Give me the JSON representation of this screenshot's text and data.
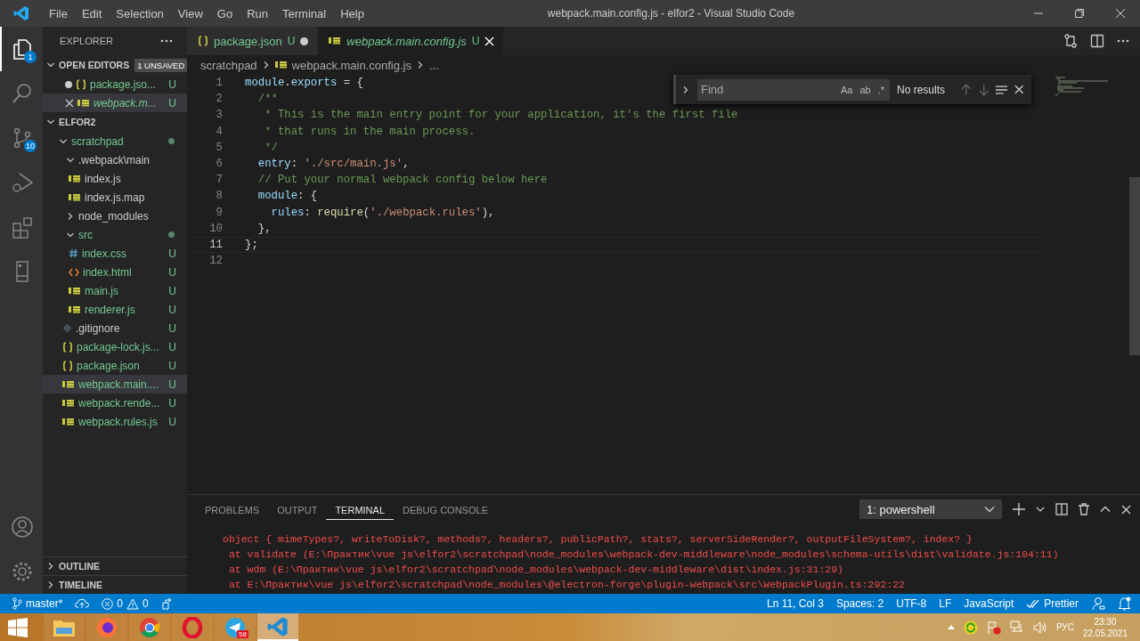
{
  "window": {
    "title": "webpack.main.config.js - elfor2 - Visual Studio Code"
  },
  "menu": [
    "File",
    "Edit",
    "Selection",
    "View",
    "Go",
    "Run",
    "Terminal",
    "Help"
  ],
  "activity_bar": [
    {
      "kind": "files",
      "selected": true,
      "badge": "1"
    },
    {
      "kind": "search",
      "selected": false
    },
    {
      "kind": "source-control",
      "selected": false,
      "badge": "10"
    },
    {
      "kind": "debug",
      "selected": false
    },
    {
      "kind": "extensions",
      "selected": false
    },
    {
      "kind": "remote",
      "selected": false
    }
  ],
  "sidebar": {
    "title": "EXPLORER",
    "open_editors": {
      "title": "OPEN EDITORS",
      "badge": "1 UNSAVED",
      "items": [
        {
          "name": "package.jso...",
          "kind": "json",
          "status": "U",
          "dirty": true,
          "italic": false,
          "selected": false
        },
        {
          "name": "webpack.m...",
          "kind": "js",
          "status": "U",
          "dirty": false,
          "italic": true,
          "selected": true
        }
      ]
    },
    "folder": {
      "title": "ELFOR2",
      "items": [
        {
          "kind": "folder",
          "name": "scratchpad",
          "expanded": true,
          "modified": true,
          "untracked": true,
          "children": [
            {
              "kind": "folder",
              "name": ".webpack\\main",
              "expanded": true,
              "modified": false,
              "untracked": false,
              "children": [
                {
                  "kind": "js",
                  "name": "index.js",
                  "untracked": false,
                  "selected": false
                },
                {
                  "kind": "js",
                  "name": "index.js.map",
                  "untracked": false,
                  "selected": false
                }
              ]
            },
            {
              "kind": "folder",
              "name": "node_modules",
              "expanded": false,
              "modified": false,
              "untracked": false
            },
            {
              "kind": "folder",
              "name": "src",
              "expanded": true,
              "modified": true,
              "untracked": true,
              "children": [
                {
                  "kind": "css",
                  "name": "index.css",
                  "status": "U",
                  "untracked": true,
                  "selected": false
                },
                {
                  "kind": "html",
                  "name": "index.html",
                  "status": "U",
                  "untracked": true,
                  "selected": false
                },
                {
                  "kind": "js",
                  "name": "main.js",
                  "status": "U",
                  "untracked": true,
                  "selected": false
                },
                {
                  "kind": "js",
                  "name": "renderer.js",
                  "status": "U",
                  "untracked": true,
                  "selected": false
                }
              ]
            },
            {
              "kind": "git",
              "name": ".gitignore",
              "status": "U",
              "untracked": false,
              "selected": false
            },
            {
              "kind": "json",
              "name": "package-lock.js...",
              "status": "U",
              "untracked": true,
              "selected": false
            },
            {
              "kind": "json",
              "name": "package.json",
              "status": "U",
              "untracked": true,
              "selected": false
            },
            {
              "kind": "js",
              "name": "webpack.main....",
              "status": "U",
              "untracked": true,
              "selected": true
            },
            {
              "kind": "js",
              "name": "webpack.rende...",
              "status": "U",
              "untracked": true,
              "selected": false
            },
            {
              "kind": "js",
              "name": "webpack.rules.js",
              "status": "U",
              "untracked": true,
              "selected": false
            }
          ]
        }
      ]
    },
    "bottom_sections": [
      "OUTLINE",
      "TIMELINE"
    ]
  },
  "editor_tabs": [
    {
      "name": "package.json",
      "kind": "json",
      "status": "U",
      "dirty": true,
      "italic": false,
      "selected": false
    },
    {
      "name": "webpack.main.config.js",
      "kind": "js",
      "status": "U",
      "dirty": false,
      "italic": true,
      "selected": true
    }
  ],
  "breadcrumbs": [
    {
      "kind": "folder",
      "text": "scratchpad"
    },
    {
      "kind": "js",
      "text": "webpack.main.config.js"
    },
    {
      "kind": "symbol",
      "text": "..."
    }
  ],
  "code": {
    "lines": [
      {
        "n": "1",
        "current": false,
        "tokens": [
          {
            "kind": "var",
            "text": "module"
          },
          {
            "kind": "plain",
            "text": "."
          },
          {
            "kind": "var",
            "text": "exports"
          },
          {
            "kind": "plain",
            "text": " = {"
          }
        ]
      },
      {
        "n": "2",
        "current": false,
        "tokens": [
          {
            "kind": "comment",
            "text": "  /**"
          }
        ]
      },
      {
        "n": "3",
        "current": false,
        "tokens": [
          {
            "kind": "comment",
            "text": "   * This is the main entry point for your application, it's the first file"
          }
        ]
      },
      {
        "n": "4",
        "current": false,
        "tokens": [
          {
            "kind": "comment",
            "text": "   * that runs in the main process."
          }
        ]
      },
      {
        "n": "5",
        "current": false,
        "tokens": [
          {
            "kind": "comment",
            "text": "   */"
          }
        ]
      },
      {
        "n": "6",
        "current": false,
        "tokens": [
          {
            "kind": "var",
            "text": "  entry"
          },
          {
            "kind": "plain",
            "text": ": "
          },
          {
            "kind": "str",
            "text": "'./src/main.js'"
          },
          {
            "kind": "plain",
            "text": ","
          }
        ]
      },
      {
        "n": "7",
        "current": false,
        "tokens": [
          {
            "kind": "comment",
            "text": "  // Put your normal webpack config below here"
          }
        ]
      },
      {
        "n": "8",
        "current": false,
        "tokens": [
          {
            "kind": "var",
            "text": "  module"
          },
          {
            "kind": "plain",
            "text": ": {"
          }
        ]
      },
      {
        "n": "9",
        "current": false,
        "tokens": [
          {
            "kind": "var",
            "text": "    rules"
          },
          {
            "kind": "plain",
            "text": ": "
          },
          {
            "kind": "func",
            "text": "require"
          },
          {
            "kind": "plain",
            "text": "("
          },
          {
            "kind": "str",
            "text": "'./webpack.rules'"
          },
          {
            "kind": "plain",
            "text": "),"
          }
        ]
      },
      {
        "n": "10",
        "current": false,
        "tokens": [
          {
            "kind": "plain",
            "text": "  },"
          }
        ]
      },
      {
        "n": "11",
        "current": true,
        "tokens": [
          {
            "kind": "plain",
            "text": "};"
          }
        ]
      },
      {
        "n": "12",
        "current": false
      }
    ]
  },
  "find_widget": {
    "placeholder": "Find",
    "options": [
      "Aa",
      "ab",
      ".*"
    ],
    "result": "No results"
  },
  "panel": {
    "tabs": [
      {
        "label": "PROBLEMS",
        "selected": false
      },
      {
        "label": "OUTPUT",
        "selected": false
      },
      {
        "label": "TERMINAL",
        "selected": true
      },
      {
        "label": "DEBUG CONSOLE",
        "selected": false
      }
    ],
    "terminal_select": "1: powershell",
    "terminal_lines": [
      "object { mimeTypes?, writeToDisk?, methods?, headers?, publicPath?, stats?, serverSideRender?, outputFileSystem?, index? }",
      " at validate (E:\\Практик\\vue js\\elfor2\\scratchpad\\node_modules\\webpack-dev-middleware\\node_modules\\schema-utils\\dist\\validate.js:104:11)",
      " at wdm (E:\\Практик\\vue js\\elfor2\\scratchpad\\node_modules\\webpack-dev-middleware\\dist\\index.js:31:29)",
      " at E:\\Практик\\vue js\\elfor2\\scratchpad\\node_modules\\@electron-forge\\plugin-webpack\\src\\WebpackPlugin.ts:292:22"
    ]
  },
  "status_bar": {
    "branch": "master*",
    "errors": "0",
    "warnings": "0",
    "right": [
      "Ln 11, Col 3",
      "Spaces: 2",
      "UTF-8",
      "LF",
      "JavaScript"
    ],
    "prettier": "Prettier"
  },
  "taskbar": {
    "apps": [
      {
        "kind": "files",
        "active": false
      },
      {
        "kind": "firefox",
        "active": false
      },
      {
        "kind": "chrome",
        "active": false
      },
      {
        "kind": "opera",
        "active": false
      },
      {
        "kind": "telegram",
        "active": false,
        "badge": "58"
      },
      {
        "kind": "vscode",
        "active": true
      }
    ],
    "language": "РУС",
    "time": "23:30",
    "date": "22.05.2021"
  }
}
